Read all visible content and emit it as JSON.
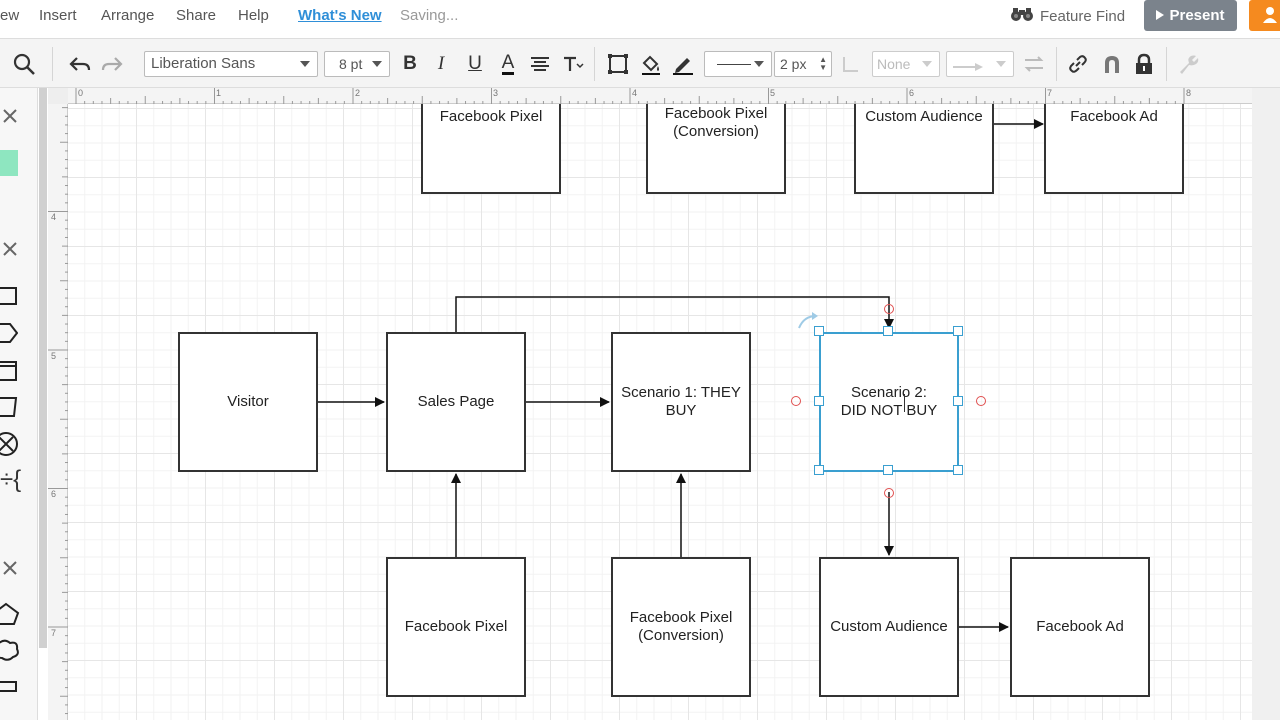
{
  "menu": {
    "view": "ew",
    "insert": "Insert",
    "arrange": "Arrange",
    "share": "Share",
    "help": "Help",
    "whats_new": "What's New",
    "saving": "Saving..."
  },
  "header": {
    "feature_find": "Feature Find",
    "present": "Present"
  },
  "toolbar": {
    "font": "Liberation Sans",
    "font_size": "8 pt",
    "bold": "B",
    "italic": "I",
    "underline": "U",
    "font_color": "A",
    "line_width": "2 px",
    "arrow_start": "None"
  },
  "rulers": {
    "top": [
      "0",
      "1",
      "2",
      "3",
      "4",
      "5",
      "6",
      "7",
      "8"
    ],
    "left": [
      "4",
      "5",
      "6",
      "7"
    ]
  },
  "shapes": {
    "top_pixel": "Facebook Pixel",
    "top_pixel_conv": "Facebook Pixel (Conversion)",
    "top_audience": "Custom Audience",
    "top_ad": "Facebook Ad",
    "visitor": "Visitor",
    "sales_page": "Sales Page",
    "scenario1": "Scenario 1: THEY BUY",
    "scenario2_line1": "Scenario 2:",
    "scenario2_line2": "DID NOT BUY",
    "bottom_pixel": "Facebook Pixel",
    "bottom_pixel_conv": "Facebook Pixel (Conversion)",
    "bottom_audience": "Custom Audience",
    "bottom_ad": "Facebook Ad"
  },
  "colors": {
    "accent": "#2f8fd8",
    "selection": "#3a9fd0",
    "present": "#7b838c",
    "share": "#f58a1f",
    "connection_point": "#e05050"
  }
}
